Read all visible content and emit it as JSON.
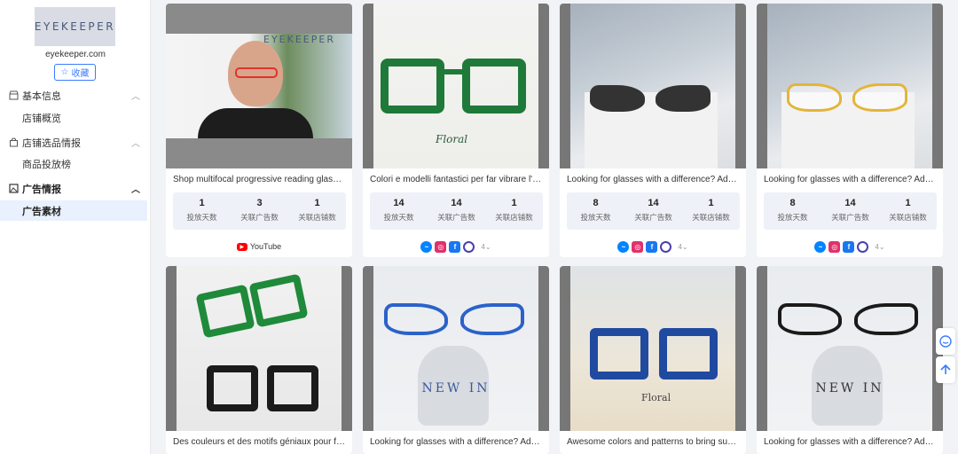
{
  "brand": {
    "logo_text": "EYEKEEPER",
    "domain": "eyekeeper.com",
    "fav_label": "收藏"
  },
  "nav": {
    "groups": [
      {
        "label": "基本信息",
        "items": [
          "店铺概览"
        ]
      },
      {
        "label": "店铺选品情报",
        "items": [
          "商品投放榜"
        ]
      },
      {
        "label": "广告情报",
        "items": [
          "广告素材"
        ]
      }
    ]
  },
  "stat_labels": [
    "投放天数",
    "关联广告数",
    "关联店铺数"
  ],
  "cards": [
    {
      "title": "Shop multifocal progressive reading glasses at EYEKEEPER",
      "stats": [
        "1",
        "3",
        "1"
      ],
      "platform_label": "YouTube",
      "thumb_text": "EYEKEEPER"
    },
    {
      "title": "Colori e modelli fantastici per far vibrare l'estate",
      "stats": [
        "14",
        "14",
        "1"
      ],
      "more": "4",
      "thumb_text": "Floral"
    },
    {
      "title": "Looking for glasses with a difference? Advanced fashion",
      "stats": [
        "8",
        "14",
        "1"
      ],
      "more": "4",
      "thumb_text": ""
    },
    {
      "title": "Looking for glasses with a difference? Advanced fashion",
      "stats": [
        "8",
        "14",
        "1"
      ],
      "more": "4",
      "thumb_text": ""
    },
    {
      "title": "Des couleurs et des motifs géniaux pour faire vibrer l'été",
      "thumb_text": ""
    },
    {
      "title": "Looking for glasses with a difference? Advanced fashion",
      "thumb_text": "NEW IN"
    },
    {
      "title": "Awesome colors and patterns to bring summer vibes",
      "thumb_text": "Floral"
    },
    {
      "title": "Looking for glasses with a difference? Advanced fashion",
      "thumb_text": "NEW IN"
    }
  ],
  "colors": {
    "accent": "#3a7bff",
    "youtube": "#ff0000",
    "messenger": "#0084ff",
    "instagram": "#e1306c",
    "facebook": "#1877f2",
    "audience": "#4a3fb0"
  }
}
